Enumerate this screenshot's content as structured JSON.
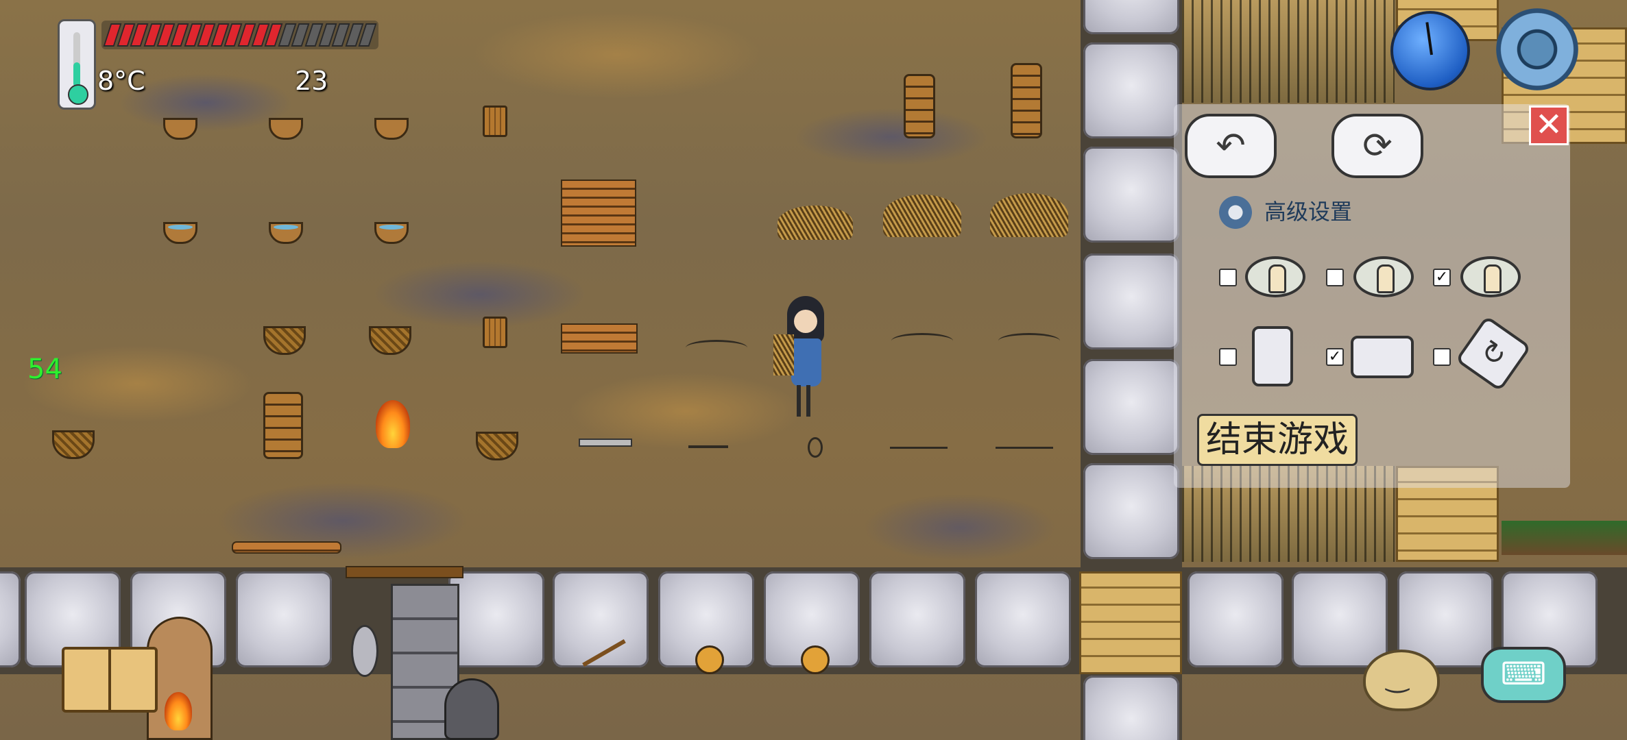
{
  "hud": {
    "temperature": "8°C",
    "food_segments_total": 20,
    "food_segments_filled": 13,
    "age": "23",
    "counter": "54"
  },
  "settings_panel": {
    "advanced_settings_label": "高级设置",
    "end_game_label": "结束游戏",
    "close_glyph": "✕",
    "undo_glyph": "↶",
    "refresh_glyph": "⟳",
    "view_options": [
      {
        "checked": false,
        "icon": "zoom-near-icon"
      },
      {
        "checked": false,
        "icon": "zoom-mid-icon"
      },
      {
        "checked": true,
        "icon": "zoom-far-icon"
      }
    ],
    "orientation_options": [
      {
        "checked": false,
        "icon": "portrait-icon"
      },
      {
        "checked": true,
        "icon": "landscape-icon"
      },
      {
        "checked": false,
        "icon": "auto-rotate-icon"
      }
    ],
    "check_glyph": "✓",
    "rotate_glyph": "↻"
  },
  "controls": {
    "keyboard_glyph": "⌨"
  },
  "colors": {
    "health_red": "#e0262e",
    "temperature_green": "#2ecfa0",
    "counter_green": "#2ef02e",
    "close_red": "#e0504e"
  }
}
